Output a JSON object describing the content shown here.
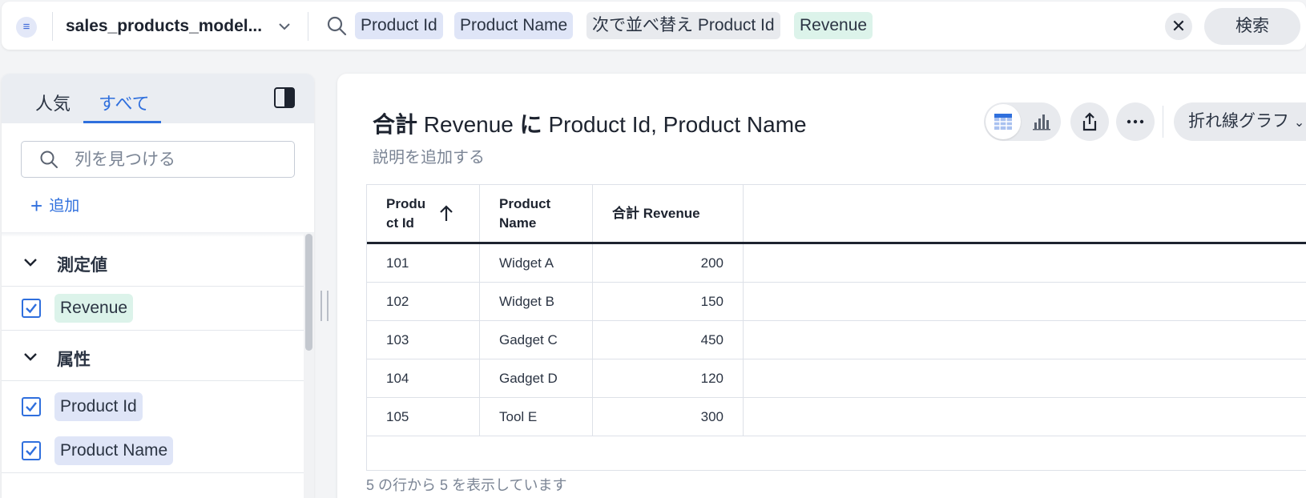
{
  "search_bar": {
    "datasource_name": "sales_products_model...",
    "tokens": [
      {
        "label": "Product Id",
        "kind": "attribute"
      },
      {
        "label": "Product Name",
        "kind": "attribute"
      },
      {
        "label": "次で並べ替え Product Id",
        "kind": "sort"
      },
      {
        "label": "Revenue",
        "kind": "measure"
      }
    ],
    "clear_label": "✕",
    "search_button_label": "検索"
  },
  "left_panel": {
    "tabs": [
      "人気",
      "すべて"
    ],
    "active_tab": "すべて",
    "find_placeholder": "列を見つける",
    "add_label": "追加",
    "sections": [
      {
        "title": "測定値",
        "columns": [
          {
            "label": "Revenue",
            "checked": true,
            "kind": "measure"
          }
        ]
      },
      {
        "title": "属性",
        "columns": [
          {
            "label": "Product Id",
            "checked": true,
            "kind": "attribute"
          },
          {
            "label": "Product Name",
            "checked": true,
            "kind": "attribute"
          }
        ]
      }
    ]
  },
  "answer": {
    "title_prefix": "合計",
    "title_measure": " Revenue ",
    "title_joiner": "に",
    "title_attributes": " Product Id, Product Name",
    "description_placeholder": "説明を追加する",
    "chart_type_label": "折れ線グラフ",
    "table": {
      "columns": [
        {
          "label_line1": "Produ",
          "label_line2": "ct Id",
          "sort": "ascending"
        },
        {
          "label_line1": "Product",
          "label_line2": "Name"
        },
        {
          "label_line1": "合計 Revenue",
          "label_line2": ""
        }
      ],
      "rows": [
        [
          "101",
          "Widget A",
          "200"
        ],
        [
          "102",
          "Widget B",
          "150"
        ],
        [
          "103",
          "Gadget C",
          "450"
        ],
        [
          "104",
          "Gadget D",
          "120"
        ],
        [
          "105",
          "Tool E",
          "300"
        ]
      ]
    },
    "footer": "5 の行から 5 を表示しています"
  },
  "colors": {
    "accent": "#2f6fdd",
    "attribute_chip": "#dfe5f7",
    "measure_chip": "#dcf3ea",
    "sort_chip": "#e8eaee"
  },
  "icons": {
    "datasource": "list-icon",
    "search": "search-icon",
    "panel_toggle": "sidebar-collapse-icon",
    "table_view": "table-icon",
    "chart_view": "bar-chart-icon",
    "share": "share-icon",
    "more": "more-horizontal-icon",
    "sort": "arrow-up-icon"
  }
}
